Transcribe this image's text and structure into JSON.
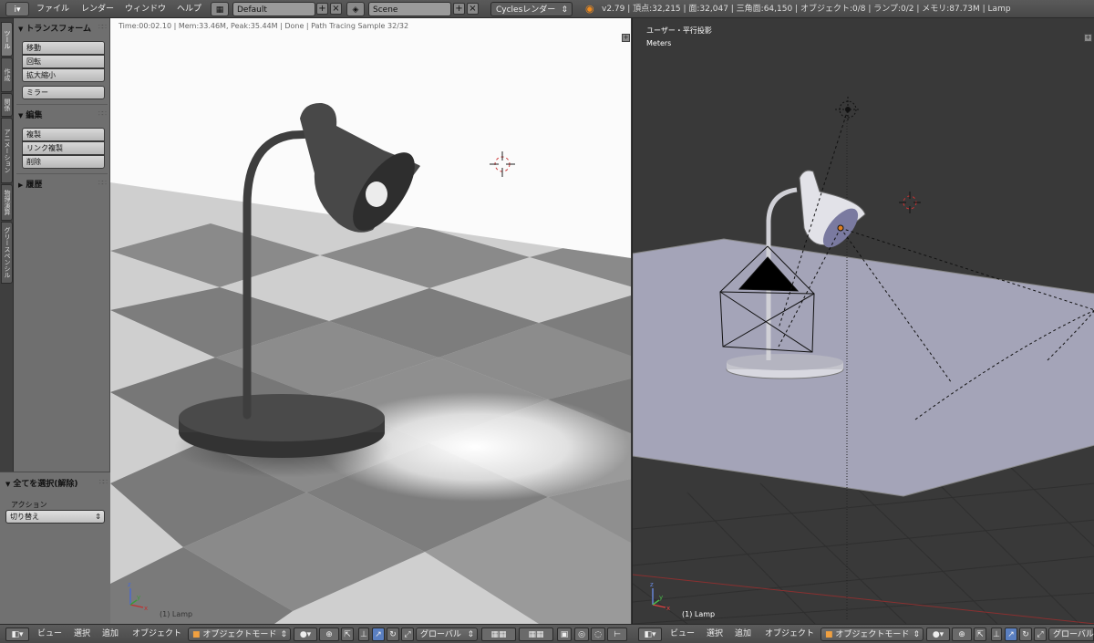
{
  "header": {
    "info_icon": "i",
    "menus": [
      "ファイル",
      "レンダー",
      "ウィンドウ",
      "ヘルプ"
    ],
    "layout_name": "Default",
    "scene_name": "Scene",
    "render_engine": "Cyclesレンダー",
    "stats": "v2.79 | 頂点:32,215 | 面:32,047 | 三角面:64,150 | オブジェクト:0/8 | ランプ:0/2 | メモリ:87.73M | Lamp"
  },
  "vtabs": [
    "ツール",
    "作成",
    "関係",
    "アニメーション",
    "物理演算",
    "グリースペンシル"
  ],
  "toolshelf": {
    "transform": {
      "title": "トランスフォーム",
      "buttons": [
        "移動",
        "回転",
        "拡大縮小"
      ],
      "mirror": "ミラー"
    },
    "edit": {
      "title": "編集",
      "buttons": [
        "複製",
        "リンク複製",
        "削除"
      ]
    },
    "history": {
      "title": "履歴"
    }
  },
  "operator": {
    "title": "全てを選択(解除)",
    "action_label": "アクション",
    "action_value": "切り替え"
  },
  "render_viewport": {
    "status": "Time:00:02.10 | Mem:33.46M, Peak:35.44M | Done | Path Tracing Sample 32/32",
    "object_label": "(1) Lamp"
  },
  "solid_viewport": {
    "view_name": "ユーザー・平行投影",
    "units": "Meters",
    "object_label": "(1) Lamp"
  },
  "bottom_left": {
    "menus": [
      "ビュー",
      "選択",
      "追加",
      "オブジェクト"
    ],
    "mode": "オブジェクトモード",
    "orientation": "グローバル"
  },
  "bottom_right": {
    "menus": [
      "ビュー",
      "選択",
      "追加",
      "オブジェクト"
    ],
    "mode": "オブジェクトモード",
    "orientation": "グローバル"
  },
  "axis_labels": {
    "x": "x",
    "y": "y",
    "z": "z"
  },
  "colors": {
    "floor_solid": "#a4a4b8",
    "lamp_solid": "#dcdce0",
    "lamp_render": "#4a4a4a",
    "selection_blue": "#5a7fc0"
  }
}
